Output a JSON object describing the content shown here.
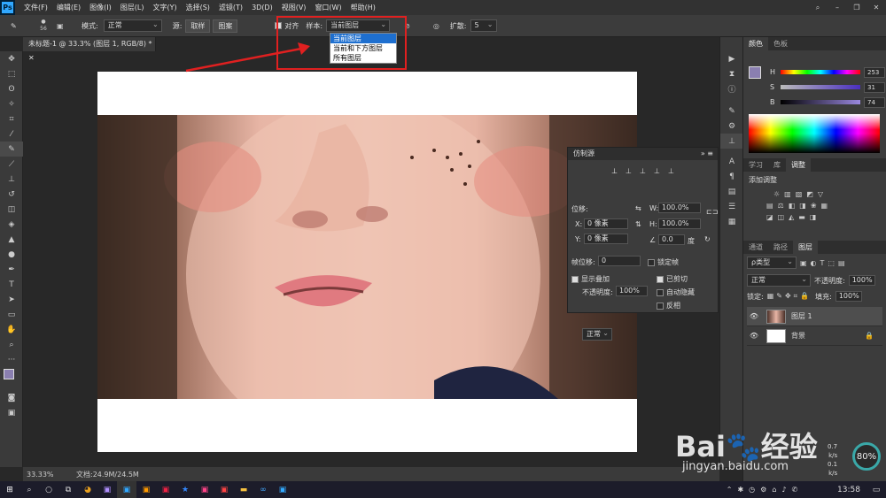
{
  "app": {
    "logo": "Ps",
    "menus": [
      "文件(F)",
      "编辑(E)",
      "图像(I)",
      "图层(L)",
      "文字(Y)",
      "选择(S)",
      "滤镜(T)",
      "3D(D)",
      "视图(V)",
      "窗口(W)",
      "帮助(H)"
    ]
  },
  "options": {
    "brush_size": "56",
    "mode_label": "模式:",
    "mode_value": "正常",
    "source_label": "源:",
    "sample_btn": "取样",
    "pattern_btn": "图案",
    "align_label": "对齐",
    "sample_label": "样本:",
    "sample_value": "当前图层",
    "diffusion_label": "扩散:",
    "diffusion_value": "5"
  },
  "sample_dropdown": [
    "当前图层",
    "当前和下方图层",
    "所有图层"
  ],
  "document": {
    "tab_title": "未标题-1 @ 33.3% (图层 1, RGB/8) *"
  },
  "status": {
    "zoom": "33.33%",
    "doc_info": "文档:24.9M/24.5M"
  },
  "color_panel": {
    "tabs": [
      "颜色",
      "色板"
    ],
    "h_label": "H",
    "h_value": "253",
    "s_label": "S",
    "s_value": "31",
    "b_label": "B",
    "b_value": "74",
    "unit": "%"
  },
  "adjust_panel": {
    "tabs": [
      "学习",
      "库",
      "调整"
    ],
    "title": "添加调整"
  },
  "layers_panel": {
    "tabs": [
      "通道",
      "路径",
      "图层"
    ],
    "kind": "ρ类型",
    "blend": "正常",
    "opacity_label": "不透明度:",
    "opacity_value": "100%",
    "lock_label": "锁定:",
    "fill_label": "填充:",
    "fill_value": "100%",
    "layers": [
      {
        "name": "图层 1"
      },
      {
        "name": "背景"
      }
    ]
  },
  "clone_panel": {
    "title": "仿制源",
    "offset_label": "位移:",
    "x_label": "X:",
    "x_value": "0 像素",
    "y_label": "Y:",
    "y_value": "0 像素",
    "w_label": "W:",
    "w_value": "100.0%",
    "h_label": "H:",
    "h_value": "100.0%",
    "angle_value": "0.0",
    "angle_unit": "度",
    "frame_label": "帧位移:",
    "frame_value": "0",
    "lock_frame": "锁定帧",
    "show_overlay": "显示叠加",
    "clipped": "已剪切",
    "opacity_label": "不透明度:",
    "opacity_value": "100%",
    "auto_hide": "自动隐藏",
    "invert": "反相",
    "blend_value": "正常"
  },
  "taskbar": {
    "time": "13:58"
  },
  "watermark": {
    "brand": "Bai",
    "brand2": "经验",
    "url": "jingyan.baidu.com",
    "percent": "80%",
    "speed1": "0.7 k/s",
    "speed2": "0.1 k/s"
  },
  "colors": {
    "fg": "#8a7fb0",
    "bg": "#ffffff",
    "accent": "#31a8ff",
    "highlight": "#e02020"
  }
}
